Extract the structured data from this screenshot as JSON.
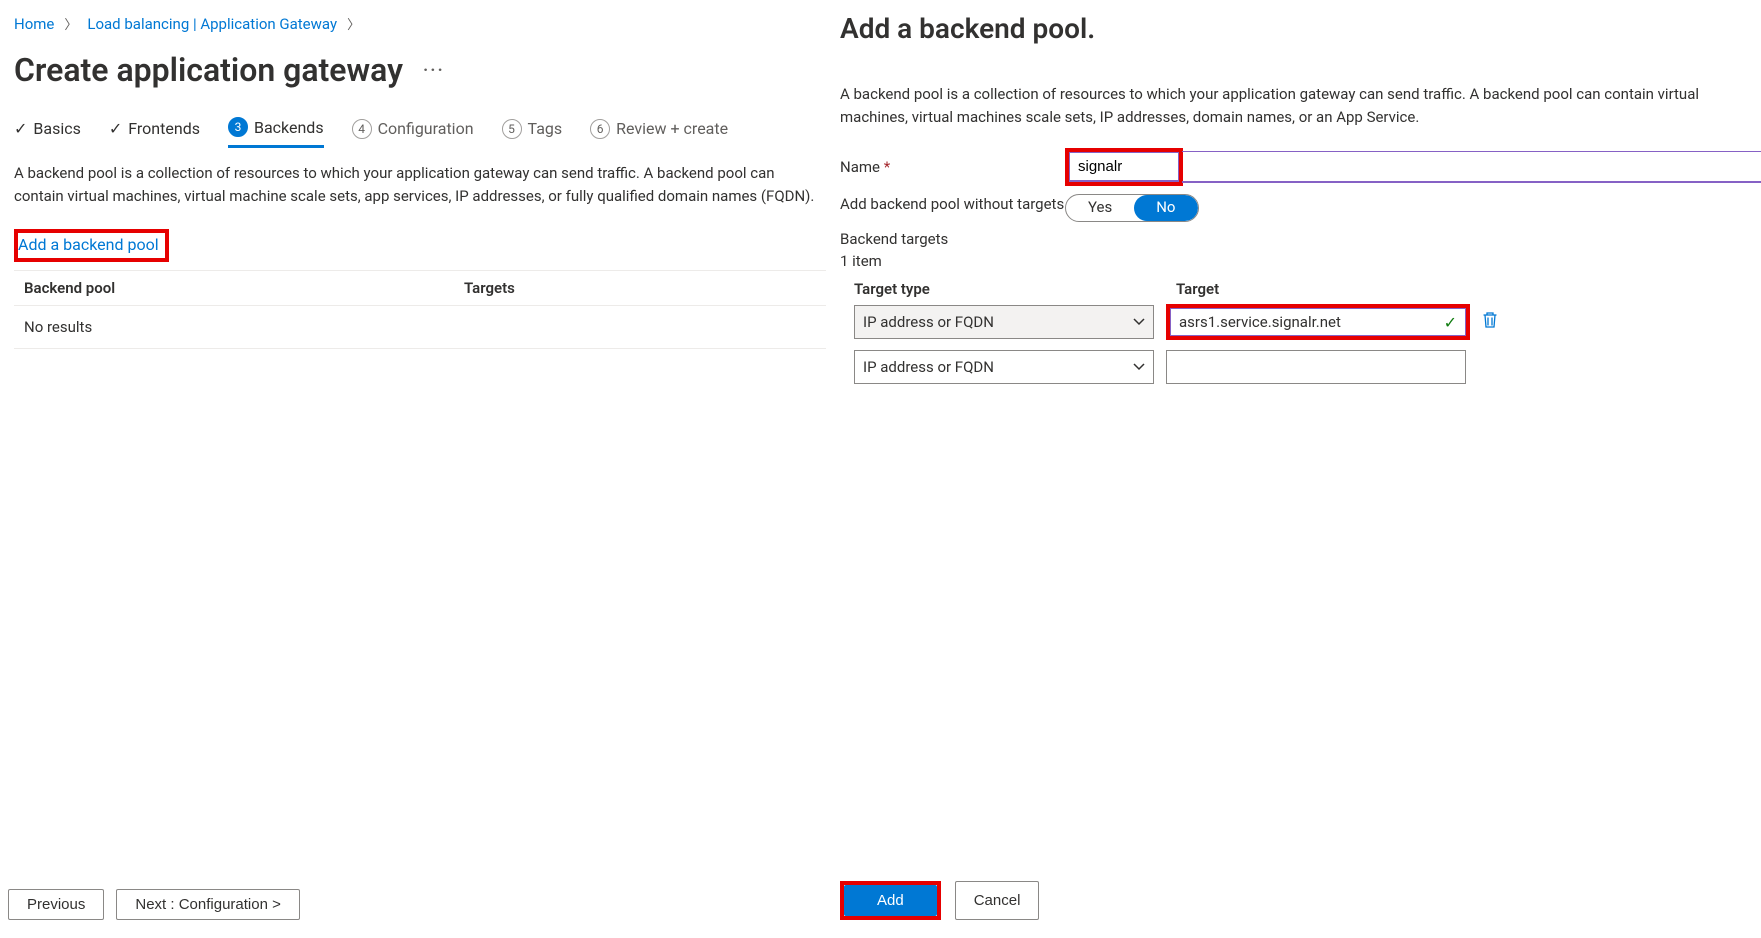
{
  "breadcrumb": {
    "home": "Home",
    "lb": "Load balancing | Application Gateway"
  },
  "page_title": "Create application gateway",
  "tabs": {
    "basics": "Basics",
    "frontends": "Frontends",
    "backends": "Backends",
    "configuration": "Configuration",
    "tags": "Tags",
    "review": "Review + create"
  },
  "description": "A backend pool is a collection of resources to which your application gateway can send traffic. A backend pool can contain virtual machines, virtual machine scale sets, app services, IP addresses, or fully qualified domain names (FQDN).",
  "add_link": "Add a backend pool",
  "grid": {
    "col_pool": "Backend pool",
    "col_targets": "Targets",
    "empty": "No results"
  },
  "footer": {
    "prev": "Previous",
    "next": "Next : Configuration >"
  },
  "panel": {
    "title": "Add a backend pool.",
    "desc": "A backend pool is a collection of resources to which your application gateway can send traffic. A backend pool can contain virtual machines, virtual machines scale sets, IP addresses, domain names, or an App Service.",
    "name_label": "Name",
    "name_value": "signalr",
    "without_targets_label": "Add backend pool without targets",
    "toggle": {
      "yes": "Yes",
      "no": "No"
    },
    "backend_targets_label": "Backend targets",
    "item_count": "1 item",
    "targets_table": {
      "head_type": "Target type",
      "head_target": "Target",
      "rows": [
        {
          "type": "IP address or FQDN",
          "target": "asrs1.service.signalr.net",
          "valid": true
        },
        {
          "type": "IP address or FQDN",
          "target": "",
          "valid": false
        }
      ]
    },
    "footer": {
      "add": "Add",
      "cancel": "Cancel"
    }
  }
}
